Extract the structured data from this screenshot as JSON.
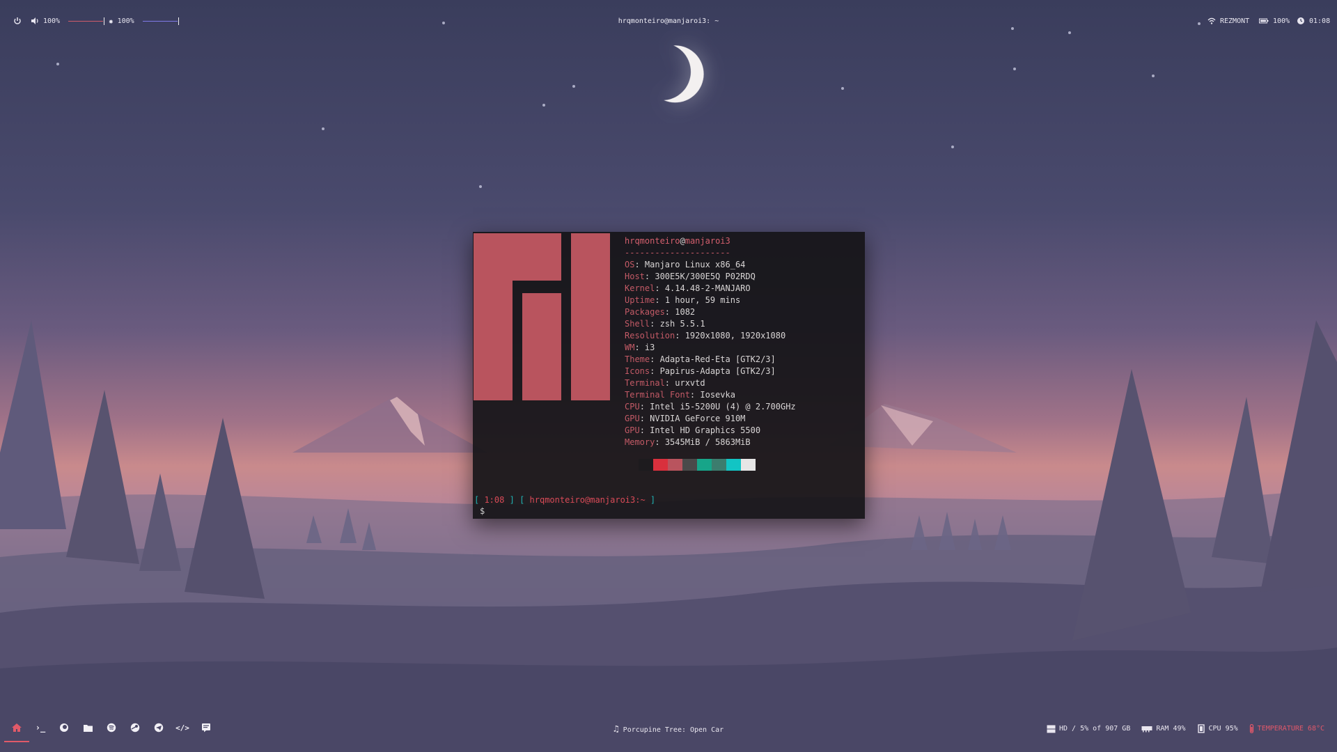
{
  "topbar": {
    "volume_value": "100%",
    "brightness_value": "100%",
    "window_title": "hrqmonteiro@manjaroi3: ~",
    "wifi_name": "REZMONT",
    "battery_value": "100%",
    "clock": "01:08",
    "accent_colors": {
      "volume": "#d05c6a",
      "brightness": "#7f7ae8"
    }
  },
  "terminal": {
    "user_host": "hrqmonteiro@manjaroi3",
    "user": "hrqmonteiro",
    "at": "@",
    "host": "manjaroi3",
    "separator": "---------------------",
    "info": [
      {
        "key": "OS",
        "value": "Manjaro Linux x86_64"
      },
      {
        "key": "Host",
        "value": "300E5K/300E5Q P02RDQ"
      },
      {
        "key": "Kernel",
        "value": "4.14.48-2-MANJARO"
      },
      {
        "key": "Uptime",
        "value": "1 hour, 59 mins"
      },
      {
        "key": "Packages",
        "value": "1082"
      },
      {
        "key": "Shell",
        "value": "zsh 5.5.1"
      },
      {
        "key": "Resolution",
        "value": "1920x1080, 1920x1080"
      },
      {
        "key": "WM",
        "value": "i3"
      },
      {
        "key": "Theme",
        "value": "Adapta-Red-Eta [GTK2/3]"
      },
      {
        "key": "Icons",
        "value": "Papirus-Adapta [GTK2/3]"
      },
      {
        "key": "Terminal",
        "value": "urxvtd"
      },
      {
        "key": "Terminal Font",
        "value": "Iosevka"
      },
      {
        "key": "CPU",
        "value": "Intel i5-5200U (4) @ 2.700GHz"
      },
      {
        "key": "GPU",
        "value": "NVIDIA GeForce 910M"
      },
      {
        "key": "GPU",
        "value": "Intel HD Graphics 5500"
      },
      {
        "key": "Memory",
        "value": "3545MiB / 5863MiB"
      }
    ],
    "palette": [
      "#1d1b1e",
      "#d9303d",
      "#b9545e",
      "#4a4a4a",
      "#17a589",
      "#3c7d6e",
      "#12c4c4",
      "#e6e6e6"
    ],
    "prompt": {
      "open": "[",
      "time": " 1:08 ",
      "close": "]",
      "open2": "[",
      "path": " hrqmonteiro@manjaroi3:~ ",
      "close2": "]",
      "symbol": "$"
    },
    "logo_color": "#b9545e"
  },
  "bottombar": {
    "launchers": [
      {
        "name": "home",
        "glyph": "⌂"
      },
      {
        "name": "terminal",
        "glyph": "›_"
      },
      {
        "name": "firefox",
        "glyph": "◕"
      },
      {
        "name": "files",
        "glyph": "▬"
      },
      {
        "name": "spotify",
        "glyph": "◉"
      },
      {
        "name": "steam",
        "glyph": "◐"
      },
      {
        "name": "telegram",
        "glyph": "➤"
      },
      {
        "name": "code",
        "glyph": "</>"
      },
      {
        "name": "chat",
        "glyph": "▣"
      }
    ],
    "now_playing": "Porcupine Tree: Open Car",
    "disk": "HD / 5% of 907 GB",
    "ram": "RAM 49%",
    "cpu": "CPU 95%",
    "temperature": "TEMPERATURE 68°C"
  }
}
